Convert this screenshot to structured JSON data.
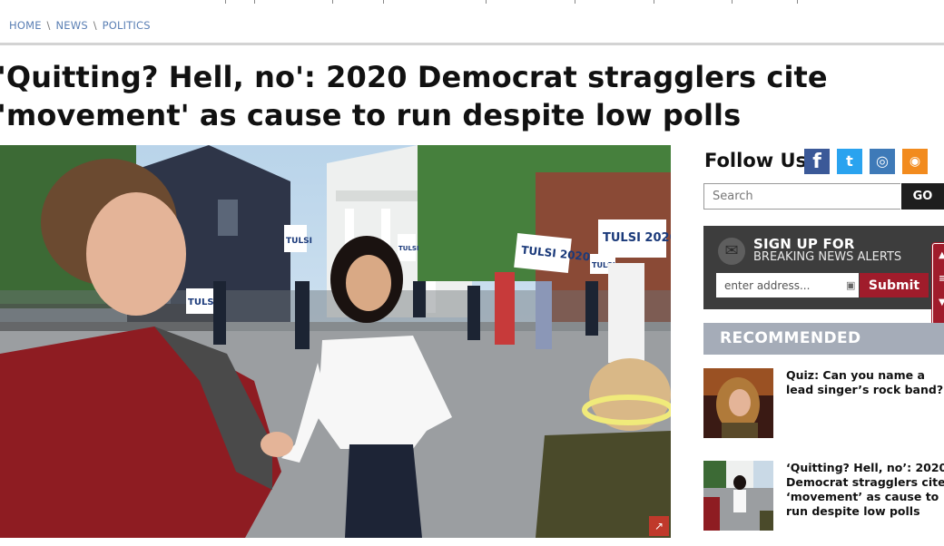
{
  "breadcrumb": {
    "home": "HOME",
    "news": "NEWS",
    "politics": "POLITICS",
    "separator": "\\"
  },
  "article": {
    "headline": "'Quitting? Hell, no': 2020 Democrat stragglers cite 'movement' as cause to run despite low polls",
    "photo_signs": [
      "TULSI",
      "TULSI",
      "TULSI",
      "TULSI",
      "TULSI 2020",
      "TULSI 2020"
    ]
  },
  "sidebar": {
    "follow_title": "Follow Us",
    "social": [
      {
        "name": "facebook-icon",
        "glyph": "f",
        "color": "#3b5998"
      },
      {
        "name": "twitter-icon",
        "glyph": "t",
        "color": "#2aa3ef"
      },
      {
        "name": "instagram-icon",
        "glyph": "◎",
        "color": "#3e7ab8"
      },
      {
        "name": "rss-icon",
        "glyph": "◉",
        "color": "#f28b1e"
      }
    ],
    "search": {
      "placeholder": "Search",
      "button": "GO"
    },
    "signup": {
      "title": "SIGN UP FOR",
      "subtitle": "BREAKING NEWS ALERTS",
      "placeholder": "enter address...",
      "button": "Submit"
    },
    "recommended_title": "RECOMMENDED",
    "recommended": [
      {
        "title": "Quiz: Can you name a lead singer’s rock band?"
      },
      {
        "title": "‘Quitting? Hell, no’: 2020 Democrat stragglers cite ‘movement’ as cause to run despite low polls"
      }
    ]
  },
  "colors": {
    "accent": "#a01c2b",
    "link": "#5a7fb4",
    "dark_panel": "#3d3d3d",
    "recommended_bar": "#a5acb8"
  }
}
